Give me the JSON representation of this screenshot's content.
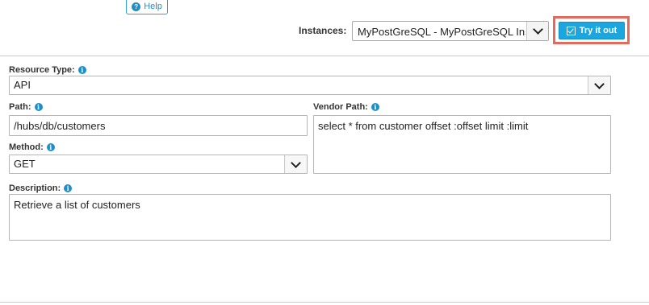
{
  "header": {
    "help_label": "Help",
    "instances_label": "Instances:",
    "instance_selected": "MyPostGreSQL - MyPostGreSQL Ins",
    "try_label": "Try it out"
  },
  "form": {
    "resource_type": {
      "label": "Resource Type:",
      "value": "API"
    },
    "path": {
      "label": "Path:",
      "value": "/hubs/db/customers"
    },
    "vendor_path": {
      "label": "Vendor Path:",
      "value": "select * from customer offset :offset limit :limit"
    },
    "method": {
      "label": "Method:",
      "value": "GET"
    },
    "description": {
      "label": "Description:",
      "value": "Retrieve a list of customers"
    }
  },
  "icons": {
    "info": "i",
    "help": "?"
  },
  "colors": {
    "accent": "#1aa6de",
    "highlight": "#e46a5e"
  }
}
